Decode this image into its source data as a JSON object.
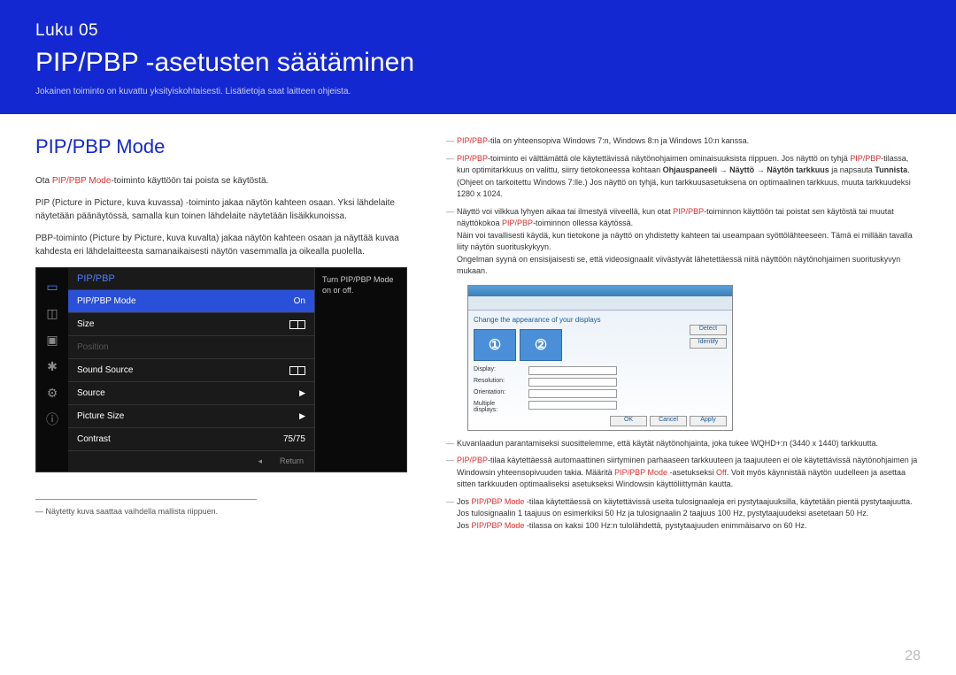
{
  "header": {
    "chapter": "Luku 05",
    "title": "PIP/PBP -asetusten säätäminen",
    "subtitle": "Jokainen toiminto on kuvattu yksityiskohtaisesti. Lisätietoja saat laitteen ohjeista."
  },
  "left": {
    "section_title": "PIP/PBP Mode",
    "p1_pre": "Ota ",
    "p1_red": "PIP/PBP Mode",
    "p1_post": "-toiminto käyttöön tai poista se käytöstä.",
    "p2": "PIP (Picture in Picture, kuva kuvassa) -toiminto jakaa näytön kahteen osaan. Yksi lähdelaite näytetään päänäytössä, samalla kun toinen lähdelaite näytetään lisäikkunoissa.",
    "p3": "PBP-toiminto (Picture by Picture, kuva kuvalta) jakaa näytön kahteen osaan ja näyttää kuvaa kahdesta eri lähdelaitteesta samanaikaisesti näytön vasemmalla ja oikealla puolella.",
    "note": "Näytetty kuva saattaa vaihdella mallista riippuen."
  },
  "osd": {
    "header": "PIP/PBP",
    "mode_label": "PIP/PBP Mode",
    "mode_value": "On",
    "size_label": "Size",
    "position_label": "Position",
    "sound_label": "Sound Source",
    "source_label": "Source",
    "picturesize_label": "Picture Size",
    "contrast_label": "Contrast",
    "contrast_value": "75/75",
    "hint": "Turn PIP/PBP Mode on or off.",
    "return": "Return"
  },
  "right": {
    "n1_pre": "",
    "n1_red": "PIP/PBP",
    "n1_post": "-tila on yhteensopiva Windows 7:n, Windows 8:n ja Windows 10:n kanssa.",
    "n2_red1": "PIP/PBP",
    "n2_t1": "-toiminto ei välttämättä ole käytettävissä näytönohjaimen ominaisuuksista riippuen. Jos näyttö on tyhjä ",
    "n2_red2": "PIP/PBP",
    "n2_t2": "-tilassa, kun optimitarkkuus on valittu, siirry tietokoneessa kohtaan ",
    "n2_b1": "Ohjauspaneeli",
    "n2_arrow1": " → ",
    "n2_b2": "Näyttö",
    "n2_arrow2": " → ",
    "n2_b3": "Näytön tarkkuus",
    "n2_t3": " ja napsauta ",
    "n2_b4": "Tunnista",
    "n2_t4": ". (Ohjeet on tarkoitettu Windows 7:lle.) Jos näyttö on tyhjä, kun tarkkuusasetuksena on optimaalinen tarkkuus, muuta tarkkuudeksi 1280 x 1024.",
    "n3_t1": "Näyttö voi vilkkua lyhyen aikaa tai ilmestyä viiveellä, kun otat ",
    "n3_red1": "PIP/PBP",
    "n3_t2": "-toiminnon käyttöön tai poistat sen käytöstä tai muutat näyttökokoa ",
    "n3_red2": "PIP/PBP",
    "n3_t3": "-toiminnon ollessa käytössä.",
    "n3_t4": "Näin voi tavallisesti käydä, kun tietokone ja näyttö on yhdistetty kahteen tai useampaan syöttölähteeseen. Tämä ei millään tavalla liity näytön suorituskykyyn.",
    "n3_t5": "Ongelman syynä on ensisijaisesti se, että videosignaalit viivästyvät lähetettäessä niitä näyttöön näytönohjaimen suorituskyvyn mukaan.",
    "win_title": "Change the appearance of your displays",
    "win_detect": "Detect",
    "win_identify": "Identify",
    "n4": "Kuvanlaadun parantamiseksi suosittelemme, että käytät näytönohjainta, joka tukee WQHD+:n (3440 x 1440) tarkkuutta.",
    "n5_red1": "PIP/PBP",
    "n5_t1": "-tilaa käytettäessä automaattinen siirtyminen parhaaseen tarkkuuteen ja taajuuteen ei ole käytettävissä näytönohjaimen ja Windowsin yhteensopivuuden takia. Määritä ",
    "n5_red2": "PIP/PBP Mode",
    "n5_t2": " -asetukseksi ",
    "n5_red3": "Off",
    "n5_t3": ". Voit myös käynnistää näytön uudelleen ja asettaa sitten tarkkuuden optimaaliseksi asetukseksi Windowsin käyttöliittymän kautta.",
    "n6_t1": "Jos ",
    "n6_red1": "PIP/PBP Mode",
    "n6_t2": " -tilaa käytettäessä on käytettävissä useita tulosignaaleja eri pystytaajuuksilla, käytetään pientä pystytaajuutta.",
    "n6_t3": "Jos tulosignaalin 1 taajuus on esimerkiksi 50 Hz ja tulosignaalin 2 taajuus 100 Hz, pystytaajuudeksi asetetaan 50 Hz.",
    "n6_t4a": "Jos ",
    "n6_red2": "PIP/PBP Mode",
    "n6_t4b": " -tilassa on kaksi 100 Hz:n tulolähdettä, pystytaajuuden enimmäisarvo on 60 Hz."
  },
  "page_number": "28"
}
